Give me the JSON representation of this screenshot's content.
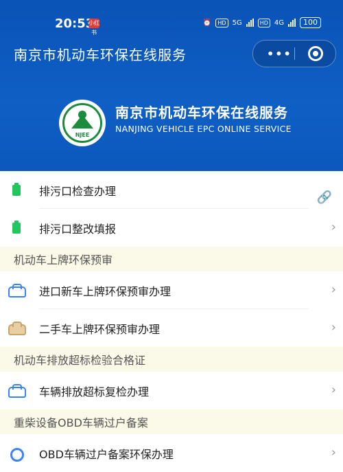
{
  "status_bar": {
    "time": "20:53",
    "badge": "小红书",
    "net1": "HD",
    "net1_sub": "5G",
    "net2": "HD",
    "net2_sub": "4G",
    "battery": "100"
  },
  "header": {
    "title": "南京市机动车环保在线服务",
    "more": "•••"
  },
  "brand": {
    "name_cn": "南京市机动车环保在线服务",
    "name_en": "NANJING VEHICLE EPC ONLINE SERVICE",
    "logo_text": "NJEE"
  },
  "list": {
    "item1": "排污口检查办理",
    "item2": "排污口整改填报",
    "section1": "机动车上牌环保预审",
    "item3": "进口新车上牌环保预审办理",
    "item4": "二手车上牌环保预审办理",
    "section2": "机动车排放超标检验合格证",
    "item5": "车辆排放超标复检办理",
    "section3": "重柴设备OBD车辆过户备案",
    "item6": "OBD车辆过户备案环保办理"
  },
  "icons": {
    "clipboard": "clipboard-icon",
    "car": "car-icon",
    "gear": "gear-icon",
    "chevron": "›",
    "link": "🔗"
  },
  "colors": {
    "header_blue": "#0f5fc5",
    "green": "#22c55e",
    "car_blue": "#3b82f6",
    "section_bg": "#fbf9e8"
  }
}
